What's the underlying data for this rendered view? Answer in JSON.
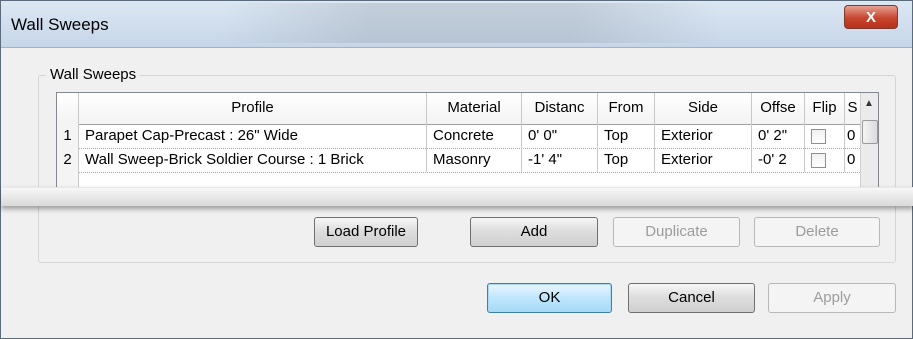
{
  "window": {
    "title": "Wall Sweeps",
    "close_glyph": "X"
  },
  "group": {
    "label": "Wall Sweeps"
  },
  "table": {
    "columns": [
      "",
      "Profile",
      "Material",
      "Distanc",
      "From",
      "Side",
      "Offse",
      "Flip",
      "S"
    ],
    "rows": [
      {
        "num": "1",
        "profile": "Parapet Cap-Precast : 26\" Wide",
        "material": "Concrete",
        "distance": "0'  0\"",
        "from": "Top",
        "side": "Exterior",
        "offset": "0'  2\"",
        "flip": false,
        "s": "0"
      },
      {
        "num": "2",
        "profile": "Wall Sweep-Brick Soldier Course : 1 Brick",
        "material": "Masonry",
        "distance": "-1'  4\"",
        "from": "Top",
        "side": "Exterior",
        "offset": "-0'  2",
        "flip": false,
        "s": "0"
      }
    ]
  },
  "buttons": {
    "load_profile": "Load Profile",
    "add": "Add",
    "duplicate": "Duplicate",
    "delete": "Delete",
    "ok": "OK",
    "cancel": "Cancel",
    "apply": "Apply"
  },
  "icons": {
    "scroll_up": "scroll-up-arrow-icon",
    "close": "close-icon"
  }
}
